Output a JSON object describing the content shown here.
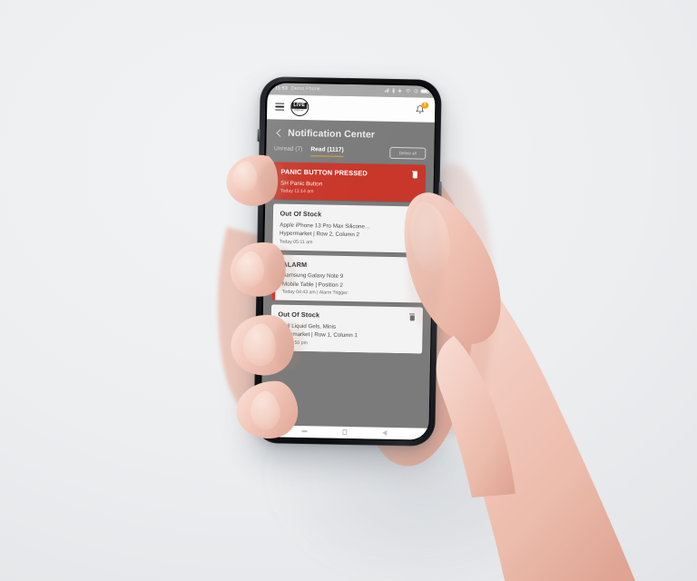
{
  "statusbar": {
    "time": "11:53",
    "device_label": "Demo Phone",
    "icons": [
      "signal-icon",
      "bluetooth-icon",
      "location-icon",
      "wifi-icon",
      "alarm-icon",
      "battery-icon"
    ]
  },
  "appbar": {
    "menu_icon": "hamburger-menu-icon",
    "logo_text": "LIVE",
    "logo_subtext": "DISPLAY",
    "bell_icon": "notification-bell-icon",
    "badge_count": "7"
  },
  "page": {
    "back_icon": "back-chevron-icon",
    "title": "Notification Center"
  },
  "tabs": {
    "unread": "Unread (7)",
    "read": "Read (1117)",
    "delete_all": "Delete all",
    "active": "read",
    "active_underline_color": "#e9a13b"
  },
  "colors": {
    "panic_red": "#c9362a",
    "alarm_accent": "#cf3a2c",
    "card_bg": "#f3f3f3",
    "screen_bg": "#7b7b7b",
    "badge": "#f0a71c"
  },
  "notifications": [
    {
      "title": "PANIC BUTTON PRESSED",
      "line1": "SH Panic Button",
      "line2": "",
      "line3": "Today 11:14 am",
      "style": "panic",
      "delete_icon": "trash-icon"
    },
    {
      "title": "Out Of Stock",
      "line1": "Apple iPhone 13 Pro Max Silicone…",
      "line2": "Hypermarket  | Row 2, Column 2",
      "line3": "Today 05:11 am",
      "style": "plain",
      "delete_icon": "trash-icon"
    },
    {
      "title": "ALARM",
      "line1": "Samsung Galaxy Note 9",
      "line2": "Mobile Table  | Position 2",
      "line3": "Today 04:43 am | Alarm Trigger:",
      "style": "accent",
      "delete_icon": "trash-icon"
    },
    {
      "title": "Out Of Stock",
      "line1": "Advil Liquid Gels, Minis",
      "line2": "Hypermarket  | Row 1, Column 1",
      "line3": "Mon 02:50 pm",
      "style": "plain",
      "delete_icon": "trash-icon"
    }
  ],
  "navbar": {
    "recents_icon": "recents-icon",
    "home_icon": "home-icon",
    "back_icon": "back-triangle-icon"
  }
}
